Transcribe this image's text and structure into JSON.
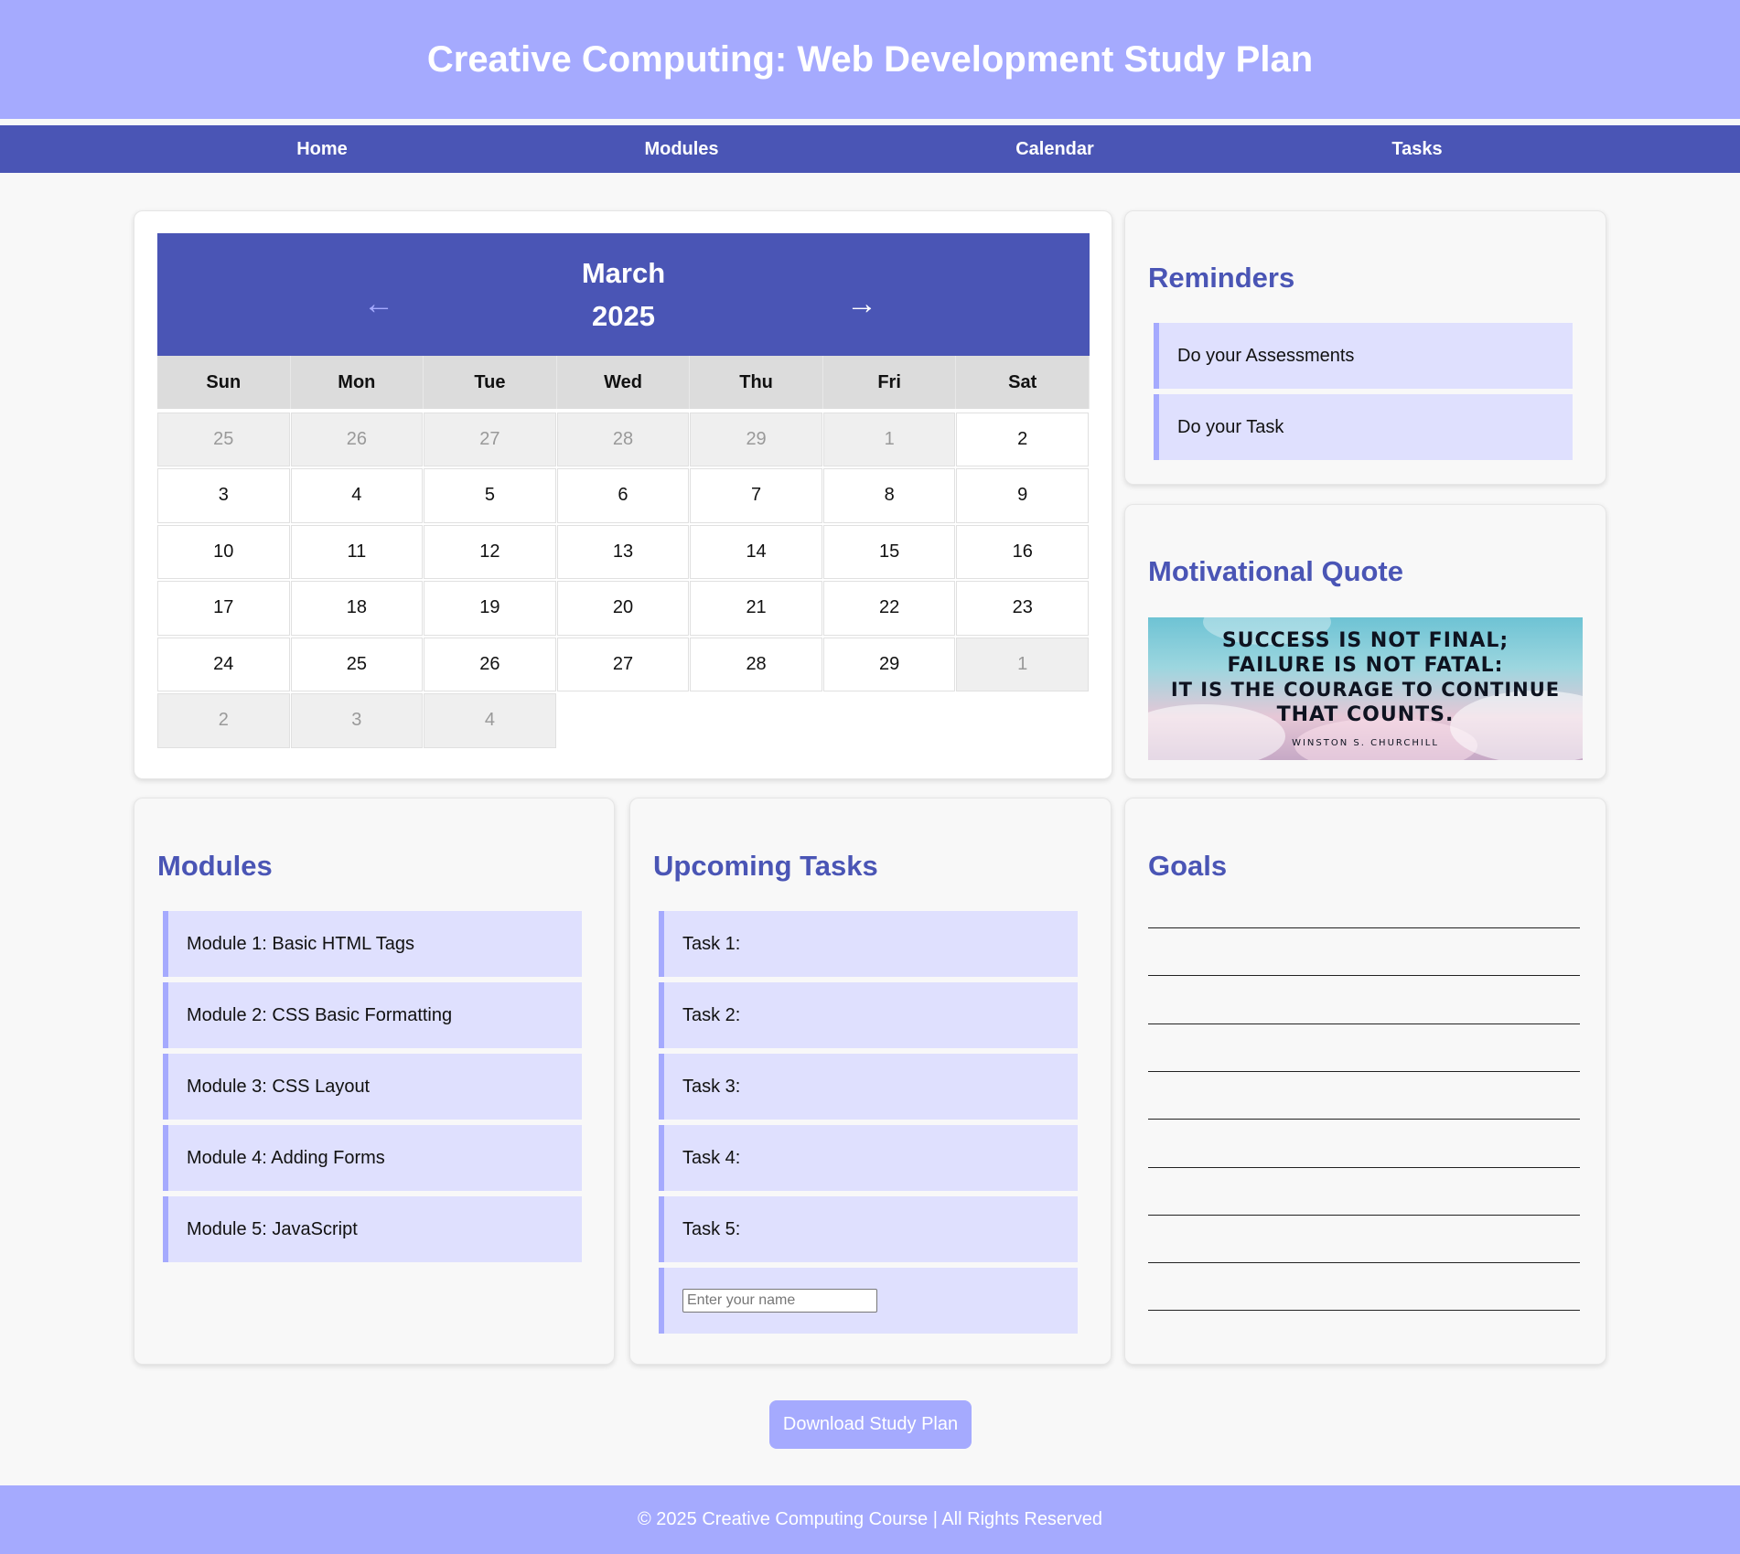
{
  "header": {
    "title": "Creative Computing: Web Development Study Plan"
  },
  "nav": [
    "Home",
    "Modules",
    "Calendar",
    "Tasks"
  ],
  "calendar": {
    "month": "March",
    "year": "2025",
    "prev_arrow": "←",
    "next_arrow": "→",
    "weekdays": [
      "Sun",
      "Mon",
      "Tue",
      "Wed",
      "Thu",
      "Fri",
      "Sat"
    ],
    "days": [
      {
        "d": "25",
        "muted": true
      },
      {
        "d": "26",
        "muted": true
      },
      {
        "d": "27",
        "muted": true
      },
      {
        "d": "28",
        "muted": true
      },
      {
        "d": "29",
        "muted": true
      },
      {
        "d": "1",
        "muted": true
      },
      {
        "d": "2",
        "muted": false
      },
      {
        "d": "3",
        "muted": false
      },
      {
        "d": "4",
        "muted": false
      },
      {
        "d": "5",
        "muted": false
      },
      {
        "d": "6",
        "muted": false
      },
      {
        "d": "7",
        "muted": false
      },
      {
        "d": "8",
        "muted": false
      },
      {
        "d": "9",
        "muted": false
      },
      {
        "d": "10",
        "muted": false
      },
      {
        "d": "11",
        "muted": false
      },
      {
        "d": "12",
        "muted": false
      },
      {
        "d": "13",
        "muted": false
      },
      {
        "d": "14",
        "muted": false
      },
      {
        "d": "15",
        "muted": false
      },
      {
        "d": "16",
        "muted": false
      },
      {
        "d": "17",
        "muted": false
      },
      {
        "d": "18",
        "muted": false
      },
      {
        "d": "19",
        "muted": false
      },
      {
        "d": "20",
        "muted": false
      },
      {
        "d": "21",
        "muted": false
      },
      {
        "d": "22",
        "muted": false
      },
      {
        "d": "23",
        "muted": false
      },
      {
        "d": "24",
        "muted": false
      },
      {
        "d": "25",
        "muted": false
      },
      {
        "d": "26",
        "muted": false
      },
      {
        "d": "27",
        "muted": false
      },
      {
        "d": "28",
        "muted": false
      },
      {
        "d": "29",
        "muted": false
      },
      {
        "d": "1",
        "muted": true
      },
      {
        "d": "2",
        "muted": true
      },
      {
        "d": "3",
        "muted": true
      },
      {
        "d": "4",
        "muted": true
      }
    ]
  },
  "reminders": {
    "title": "Reminders",
    "items": [
      "Do your Assessments",
      "Do your Task"
    ]
  },
  "quote": {
    "title": "Motivational Quote",
    "lines": [
      "SUCCESS IS NOT FINAL;",
      "FAILURE IS NOT FATAL:",
      "IT IS THE COURAGE TO CONTINUE",
      "THAT COUNTS."
    ],
    "author": "WINSTON S. CHURCHILL"
  },
  "modules": {
    "title": "Modules",
    "items": [
      "Module 1: Basic HTML Tags",
      "Module 2: CSS Basic Formatting",
      "Module 3: CSS Layout",
      "Module 4: Adding Forms",
      "Module 5: JavaScript"
    ]
  },
  "tasks": {
    "title": "Upcoming Tasks",
    "items": [
      "Task 1:",
      "Task 2:",
      "Task 3:",
      "Task 4:",
      "Task 5:"
    ],
    "name_placeholder": "Enter your name"
  },
  "goals": {
    "title": "Goals",
    "line_count": 9
  },
  "download_label": "Download Study Plan",
  "footer": "© 2025 Creative Computing Course | All Rights Reserved",
  "colors": {
    "header_bg": "#a5aafe",
    "nav_bg": "#4a55b5",
    "heading": "#4a55b5",
    "item_bg": "#dfe0fe",
    "item_border": "#a5aafe"
  }
}
